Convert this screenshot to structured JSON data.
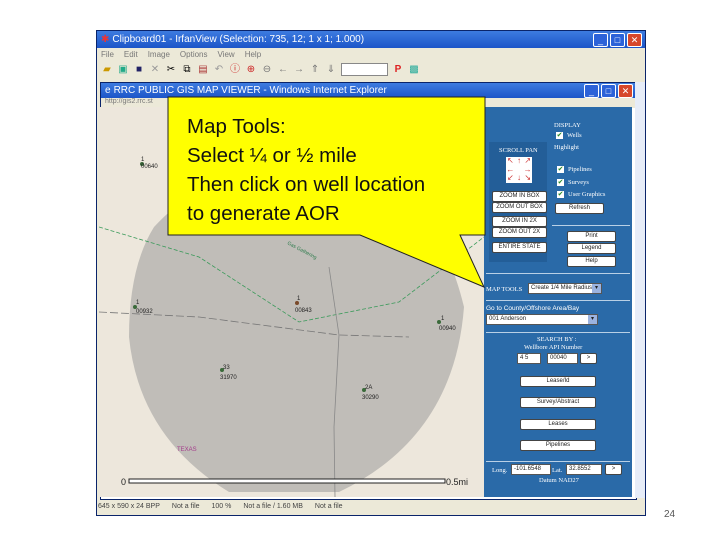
{
  "irfanview": {
    "title": "Clipboard01 - IrfanView (Selection: 735, 12; 1 x 1; 1.000)",
    "menu": [
      "File",
      "Edit",
      "Image",
      "Options",
      "View",
      "Help"
    ],
    "status": [
      "645 x 590 x 24 BPP",
      "Not a file",
      "100 %",
      "Not a file / 1.60 MB",
      "Not a file"
    ]
  },
  "ie": {
    "title": "RRC PUBLIC GIS MAP VIEWER - Windows Internet Explorer",
    "address": "http://gis2.rrc.st"
  },
  "map": {
    "wells": [
      {
        "num": "1",
        "api": "00640"
      },
      {
        "num": "1",
        "api": "00932"
      },
      {
        "num": "1",
        "api": "00843"
      },
      {
        "num": "1",
        "api": "00940"
      },
      {
        "num": "33",
        "api": "31970"
      },
      {
        "num": "2A",
        "api": "30290"
      }
    ],
    "label_texas": "TEXAS",
    "pipeline_label": "Gas Gathering",
    "scale_start": "0",
    "scale_end": "0.5mi"
  },
  "panel": {
    "display": "DISPLAY",
    "wells": "Wells",
    "highlight": "Highlight",
    "pipelines": "Pipelines",
    "surveys": "Surveys",
    "user_graphics": "User Graphics",
    "refresh": "Refresh",
    "scroll_pan": "SCROLL PAN",
    "zoom_in_box": "ZOOM IN BOX",
    "zoom_out_box": "ZOOM OUT BOX",
    "zoom_in_2x": "ZOOM IN 2X",
    "zoom_out_2x": "ZOOM OUT 2X",
    "entire_state": "ENTIRE STATE",
    "print": "Print",
    "legend": "Legend",
    "help": "Help",
    "map_tools_label": "MAP TOOLS",
    "map_tools_value": "Create 1/4 Mile Radius",
    "goto_label": "Go to County/Offshore Area/Bay",
    "goto_value": "001 Anderson",
    "search_by": "SEARCH BY :",
    "wellbore_api": "Wellbore API Number",
    "api_a": "4 5",
    "api_b": "00040",
    "go": ">",
    "lease_id": "Lease/Id",
    "survey_abstract": "Survey/Abstract",
    "leases": "Leases",
    "pipelines_btn": "Pipelines",
    "long_label": "Long.",
    "long_value": "-101.6548",
    "lat_label": "Lat.",
    "lat_value": "32.8552",
    "datum": "Datum NAD27"
  },
  "callout": {
    "lines": [
      "Map Tools:",
      "Select ¼ or ½ mile",
      "Then click on well location",
      "to generate AOR"
    ]
  },
  "slide_number": "24"
}
